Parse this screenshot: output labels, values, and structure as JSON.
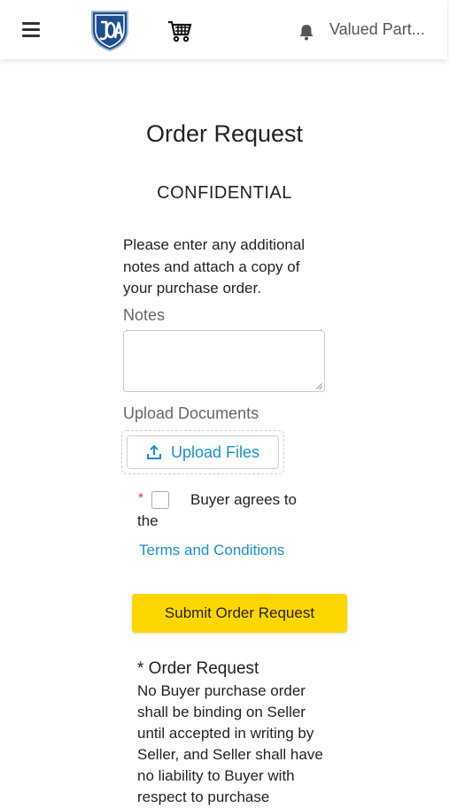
{
  "header": {
    "user_name": "Valued Part...",
    "icons": [
      "menu-icon",
      "logo",
      "cart-icon",
      "bell-icon"
    ]
  },
  "page": {
    "title": "Order Request",
    "confidential": "CONFIDENTIAL",
    "instructions": "Please enter any additional notes and attach a copy of your purchase order."
  },
  "form": {
    "notes_label": "Notes",
    "notes_value": "",
    "upload_label": "Upload Documents",
    "upload_button": "Upload Files",
    "required_marker": "*",
    "agree_text_1": "Buyer agrees to",
    "agree_text_2": "the",
    "terms_link": "Terms and Conditions",
    "submit_button": "Submit Order Request"
  },
  "footer_note": {
    "title": "* Order Request",
    "body": "No Buyer purchase order shall be binding on Seller until accepted in writing by Seller, and Seller shall have no liability to Buyer with respect to purchase"
  },
  "colors": {
    "accent_yellow": "#ffd700",
    "link_blue": "#1b8fc4",
    "required_red": "#e03030",
    "logo_blue": "#1f4e8c"
  }
}
